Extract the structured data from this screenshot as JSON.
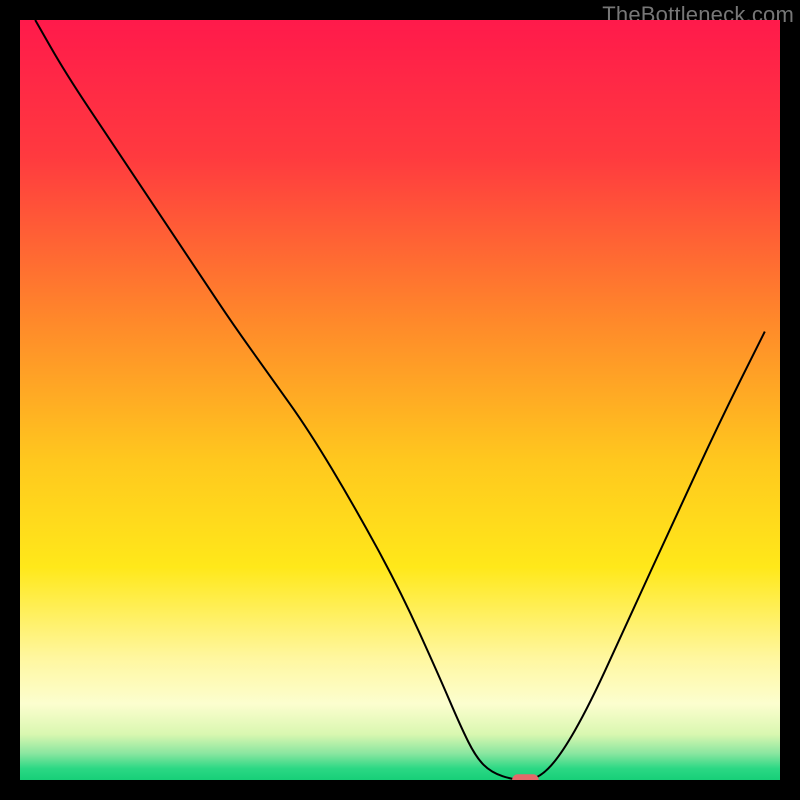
{
  "watermark": "TheBottleneck.com",
  "chart_data": {
    "type": "line",
    "title": "",
    "xlabel": "",
    "ylabel": "",
    "xlim": [
      0,
      100
    ],
    "ylim": [
      0,
      100
    ],
    "grid": false,
    "legend": false,
    "background_gradient_stops": [
      {
        "offset": 0.0,
        "color": "#ff1a4b"
      },
      {
        "offset": 0.18,
        "color": "#ff3a3f"
      },
      {
        "offset": 0.4,
        "color": "#ff8a2a"
      },
      {
        "offset": 0.58,
        "color": "#ffc81e"
      },
      {
        "offset": 0.72,
        "color": "#ffe81a"
      },
      {
        "offset": 0.84,
        "color": "#fff7a0"
      },
      {
        "offset": 0.9,
        "color": "#fcfecf"
      },
      {
        "offset": 0.94,
        "color": "#d9f7b0"
      },
      {
        "offset": 0.965,
        "color": "#8ae6a0"
      },
      {
        "offset": 0.985,
        "color": "#2bd884"
      },
      {
        "offset": 1.0,
        "color": "#17cf78"
      }
    ],
    "series": [
      {
        "name": "bottleneck-curve",
        "color": "#000000",
        "stroke_width": 2,
        "x": [
          2,
          6,
          12,
          18,
          24,
          28,
          33,
          38,
          44,
          50,
          55,
          58,
          60,
          62,
          65,
          68,
          71,
          75,
          80,
          86,
          92,
          98
        ],
        "y": [
          100,
          93,
          84,
          75,
          66,
          60,
          53,
          46,
          36,
          25,
          14,
          7,
          3,
          1,
          0,
          0,
          3,
          10,
          21,
          34,
          47,
          59
        ]
      }
    ],
    "marker": {
      "name": "optimal-point",
      "x": 66.5,
      "y": 0,
      "width": 3.5,
      "height": 1.5,
      "color": "#e46a6a"
    }
  }
}
